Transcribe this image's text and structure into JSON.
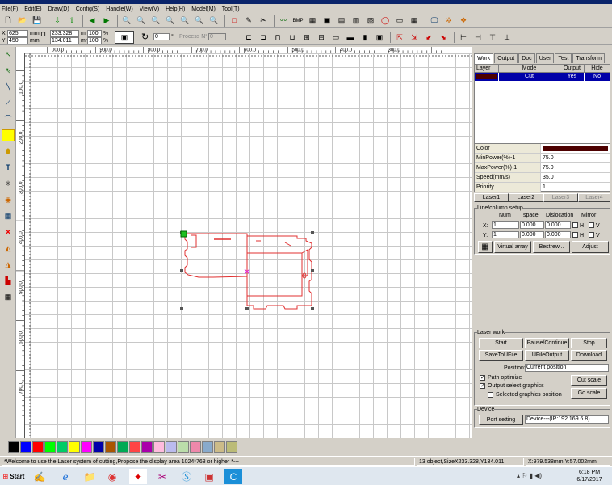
{
  "menu": [
    "File(F)",
    "Edit(E)",
    "Draw(D)",
    "Config(S)",
    "Handle(W)",
    "View(V)",
    "Help(H)",
    "Model(M)",
    "Tool(T)"
  ],
  "toolbar2": {
    "x_label": "X",
    "x_value": "625",
    "x_unit": "mm",
    "y_label": "Y",
    "y_value": "450",
    "y_unit": "mm",
    "w_value": "233.328",
    "w_unit": "mm",
    "h_value": "134.011",
    "h_unit": "mm",
    "sx_value": "100",
    "sx_unit": "%",
    "sy_value": "100",
    "sy_unit": "%",
    "rotate_value": "0",
    "rotate_unit": "°",
    "process_label": "Process N°",
    "process_value": "0"
  },
  "ruler_top": [
    "000.0",
    "900.0",
    "800.0",
    "700.0",
    "600.0",
    "500.0",
    "400.0",
    "300.0"
  ],
  "ruler_left": [
    "100.0",
    "200.0",
    "300.0",
    "400.0",
    "500.0",
    "600.0",
    "700.0"
  ],
  "palette": [
    "#000000",
    "#0000ff",
    "#ff0000",
    "#00ff00",
    "#00cc66",
    "#ffff00",
    "#ff00ff",
    "#0000aa",
    "#aa5500",
    "#00aa55",
    "#ff4444",
    "#aa00aa",
    "#ffbbdd",
    "#bbbbee",
    "#bbddaa",
    "#ee88aa",
    "#88aacc",
    "#ccbb88",
    "#bbbb77"
  ],
  "status": {
    "message": "*Welcome to use the Laser system of cutting,Propose the display area 1024*768 or higher *---",
    "selection": "13 object,SizeX233.328,Y134.011",
    "coords": "X:979.538mm,Y:57.002mm"
  },
  "taskbar": {
    "start": "Start",
    "time": "6:18 PM",
    "date": "6/17/2017"
  },
  "panel": {
    "tabs": [
      "Work",
      "Output",
      "Doc",
      "User",
      "Test",
      "Transform"
    ],
    "layer_table": {
      "headers": [
        "Layer",
        "Mode",
        "Output",
        "Hide"
      ],
      "rows": [
        {
          "color": "#4d0000",
          "mode": "Cut",
          "output": "Yes",
          "hide": "No"
        }
      ]
    },
    "properties": [
      {
        "name": "Color",
        "value": ""
      },
      {
        "name": "MinPower(%)-1",
        "value": "75.0"
      },
      {
        "name": "MaxPower(%)-1",
        "value": "75.0"
      },
      {
        "name": "Speed(mm/s)",
        "value": "35.0"
      },
      {
        "name": "Priority",
        "value": "1"
      }
    ],
    "property_color": "#4d0000",
    "laser_buttons": [
      "Laser1",
      "Laser2",
      "Laser3",
      "Laser4"
    ],
    "array": {
      "title": "Line/column setup",
      "col_num": "Num",
      "col_space": "space",
      "col_dislocation": "Dislocation",
      "col_mirror": "Mirror",
      "x_label": "X:",
      "x_num": "1",
      "x_space": "0.000",
      "x_disloc": "0.000",
      "y_label": "Y:",
      "y_num": "1",
      "y_space": "0.000",
      "y_disloc": "0.000",
      "h_label": "H",
      "v_label": "V",
      "virtual_array": "Virtual array",
      "bestrew": "Bestrew...",
      "adjust": "Adjust"
    },
    "laser_work": {
      "title": "Laser work",
      "start": "Start",
      "pause": "Pause/Continue",
      "stop": "Stop",
      "save_ufile": "SaveToUFile",
      "ufile_output": "UFileOutput",
      "download": "Download",
      "position_label": "Position:",
      "position_value": "Current position",
      "path_optimize": "Path optimize",
      "output_select": "Output select graphics",
      "selected_pos": "Selected graphics position",
      "cut_scale": "Cut scale",
      "go_scale": "Go scale"
    },
    "device": {
      "title": "Device",
      "port_setting": "Port setting",
      "device_value": "Device---(IP:192.169.6.8)"
    }
  }
}
